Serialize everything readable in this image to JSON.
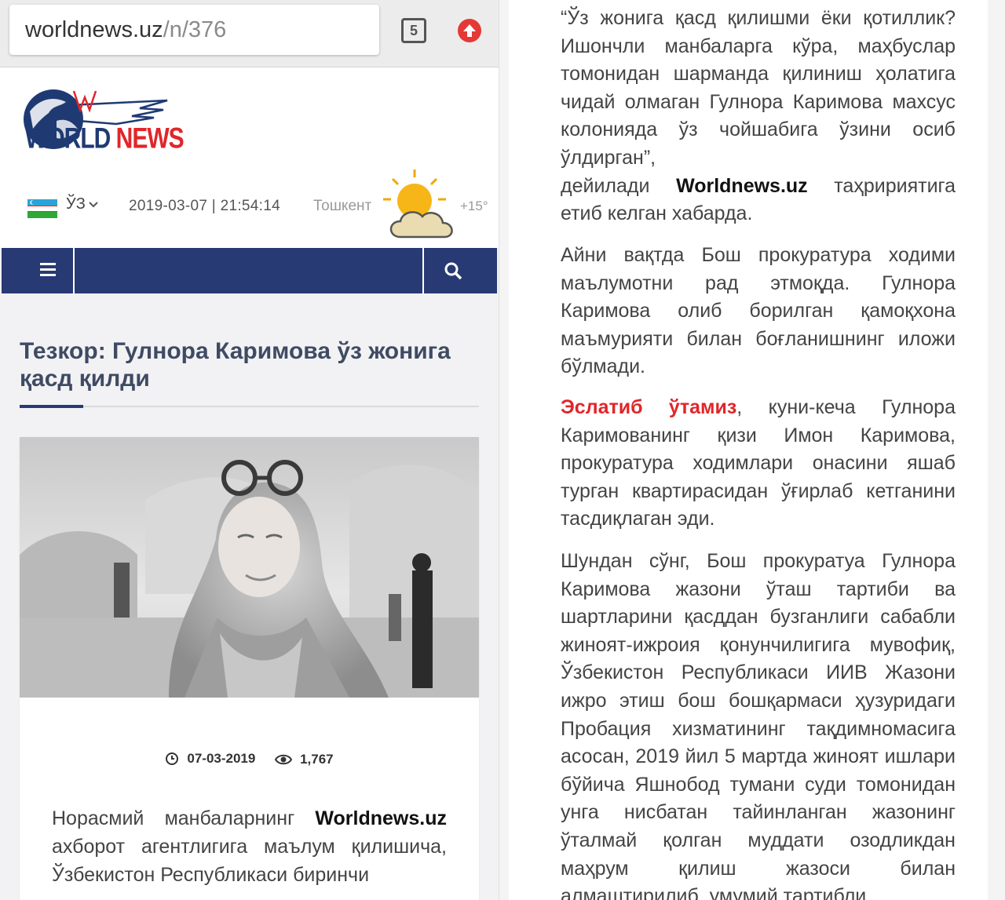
{
  "browser": {
    "url_domain": "worldnews.uz",
    "url_path": "/n/376",
    "tab_count": "5"
  },
  "site": {
    "logo_text_world": "WORLD",
    "logo_text_news": "NEWS",
    "language": "ЎЗ",
    "datetime": "2019-03-07 | 21:54:14",
    "city": "Тошкент",
    "temperature": "+15°"
  },
  "article": {
    "title": "Тезкор: Гулнора Каримова ўз жонига қасд қилди",
    "date": "07-03-2019",
    "views": "1,767",
    "lead_1": "Норасмий манбаларнинг",
    "lead_brand": "Worldnews.uz",
    "lead_2": "ахборот агентлигига маълум қилишича, Ўзбекистон Республикаси биринчи"
  },
  "continuation": {
    "p1_text": "“Ўз жонига қасд қилишми ёки қотиллик? Ишончли манбаларга кўра, маҳбуслар томонидан шарманда қилиниш ҳолатига чидай олмаган Гулнора Каримова махсус колонияда ўз чойшабига ўзини осиб ўлдирган”,",
    "p1_pre": "дейилади",
    "p1_brand": "Worldnews.uz",
    "p1_post": "таҳририятига етиб келган хабарда.",
    "p2": "Айни вақтда Бош прокуратура ходими маълумотни рад этмоқда. Гулнора Каримова олиб борилган қамоқхона маъмурияти билан боғланишнинг иложи бўлмади.",
    "p3_highlight": "Эслатиб ўтамиз",
    "p3_rest": ", куни-кеча Гулнора Каримованинг қизи Имон Каримова, прокуратура ходимлари онасини яшаб турган квартирасидан ўғирлаб кетганини тасдиқлаган эди.",
    "p4": "Шундан сўнг, Бош прокуратуа Гулнора Каримова жазони ўташ тартиби ва шартларини қасддан бузганлиги сабабли жиноят-ижроия қонунчилигига мувофиқ, Ўзбекистон Республикаси ИИВ Жазони ижро этиш бош бошқармаси ҳузуридаги Пробация хизматининг тақдимномасига асосан, 2019 йил 5 мартда жиноят ишлари бўйича Яшнобод тумани суди томонидан унга нисбатан тайинланган жазонинг ўталмай қолган муддати озодликдан маҳрум қилиш жазоси билан алмаштирилиб, умумий тартибли"
  },
  "icons": {
    "tabs": "tabs-counter-icon",
    "upload": "upload-arrow-icon",
    "menu": "hamburger-menu-icon",
    "search": "search-icon",
    "clock": "clock-icon",
    "views": "eye-icon",
    "weather": "partly-cloudy-icon",
    "flag": "uzbekistan-flag-icon"
  },
  "colors": {
    "nav": "#283a73",
    "brand_red": "#e0262a",
    "title": "#3f4b63"
  }
}
